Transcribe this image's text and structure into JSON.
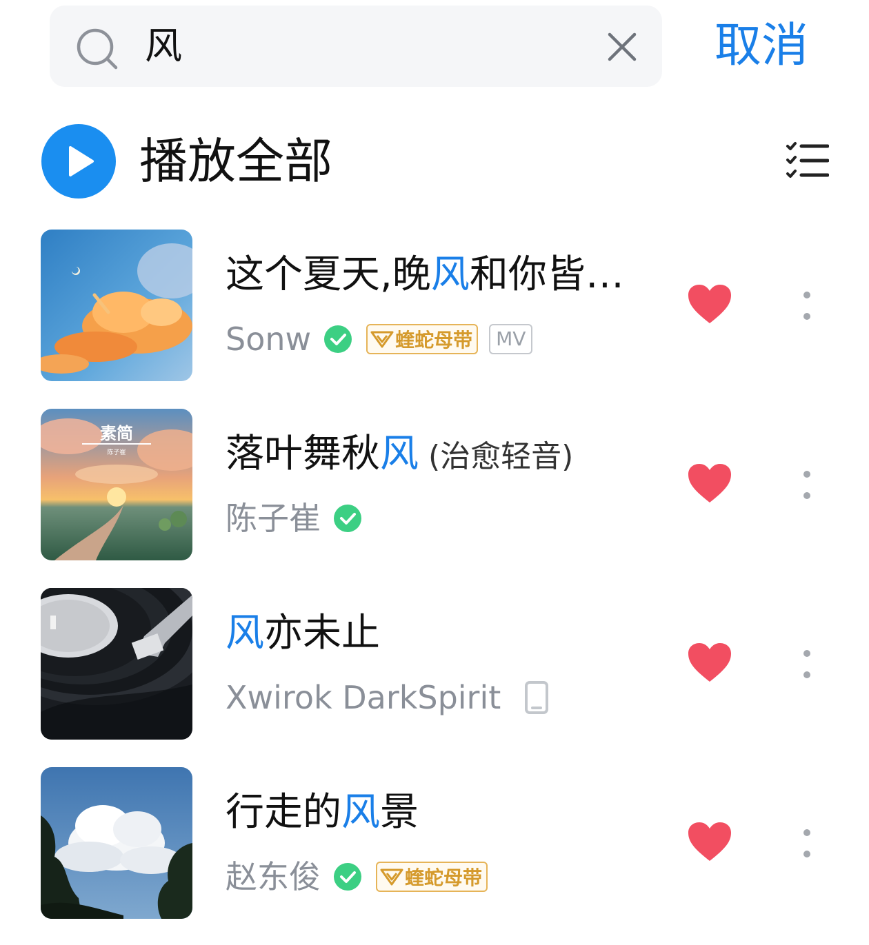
{
  "search": {
    "value": "风",
    "cancel_label": "取消"
  },
  "play_all": {
    "label": "播放全部"
  },
  "colors": {
    "accent": "#1a7fe8",
    "heart": "#f24e61",
    "verified": "#3ccf83",
    "vip_gold": "#d59a2c"
  },
  "songs": [
    {
      "title_before": "这个夏天,晚",
      "title_highlight": "风",
      "title_after": "和你皆…",
      "title_suffix": "",
      "artist": "Sonw",
      "verified": true,
      "vip_label": "蝰蛇母带",
      "mv_label": "MV",
      "liked": true
    },
    {
      "title_before": "落叶舞秋",
      "title_highlight": "风",
      "title_after": "",
      "title_suffix": "(治愈轻音)",
      "artist": "陈子崔",
      "verified": true,
      "cover_text": "素简",
      "cover_subtext": "陈子崔",
      "liked": true
    },
    {
      "title_before": "",
      "title_highlight": "风",
      "title_after": "亦未止",
      "title_suffix": "",
      "artist": "Xwirok DarkSpirit",
      "device_icon": "phone-icon",
      "liked": true
    },
    {
      "title_before": "行走的",
      "title_highlight": "风",
      "title_after": "景",
      "title_suffix": "",
      "artist": "赵东俊",
      "verified": true,
      "vip_label": "蝰蛇母带",
      "liked": true
    }
  ]
}
